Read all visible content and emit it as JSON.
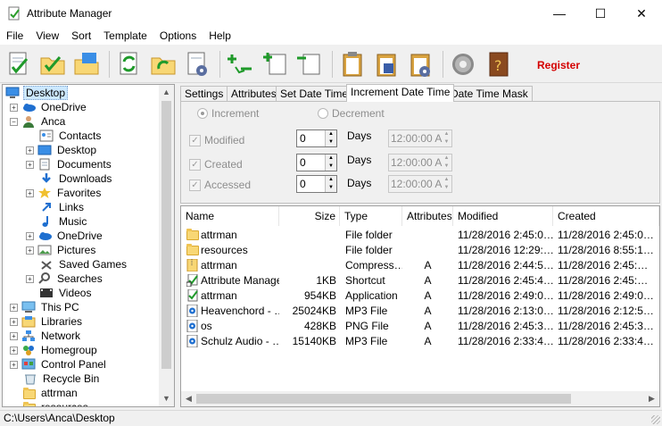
{
  "window": {
    "title": "Attribute Manager",
    "minimize": "—",
    "maximize": "☐",
    "close": "✕"
  },
  "menu": [
    "File",
    "View",
    "Sort",
    "Template",
    "Options",
    "Help"
  ],
  "toolbar": {
    "register_label": "Register"
  },
  "tree": {
    "items": [
      {
        "label": "Desktop",
        "icon": "desktop-icon",
        "expander": ""
      },
      {
        "label": "OneDrive",
        "icon": "cloud-icon",
        "expander": "+"
      },
      {
        "label": "Anca",
        "icon": "user-icon",
        "expander": "−"
      },
      {
        "label": "Contacts",
        "icon": "contacts-icon",
        "expander": ""
      },
      {
        "label": "Desktop",
        "icon": "desktop-icon",
        "expander": "+"
      },
      {
        "label": "Documents",
        "icon": "documents-icon",
        "expander": "+"
      },
      {
        "label": "Downloads",
        "icon": "download-icon",
        "expander": ""
      },
      {
        "label": "Favorites",
        "icon": "star-icon",
        "expander": "+"
      },
      {
        "label": "Links",
        "icon": "links-icon",
        "expander": ""
      },
      {
        "label": "Music",
        "icon": "music-icon",
        "expander": ""
      },
      {
        "label": "OneDrive",
        "icon": "cloud-icon",
        "expander": "+"
      },
      {
        "label": "Pictures",
        "icon": "pictures-icon",
        "expander": "+"
      },
      {
        "label": "Saved Games",
        "icon": "games-icon",
        "expander": ""
      },
      {
        "label": "Searches",
        "icon": "search-icon",
        "expander": "+"
      },
      {
        "label": "Videos",
        "icon": "video-icon",
        "expander": ""
      },
      {
        "label": "This PC",
        "icon": "computer-icon",
        "expander": "+"
      },
      {
        "label": "Libraries",
        "icon": "library-icon",
        "expander": "+"
      },
      {
        "label": "Network",
        "icon": "network-icon",
        "expander": "+"
      },
      {
        "label": "Homegroup",
        "icon": "homegroup-icon",
        "expander": "+"
      },
      {
        "label": "Control Panel",
        "icon": "control-panel-icon",
        "expander": "+"
      },
      {
        "label": "Recycle Bin",
        "icon": "recycle-bin-icon",
        "expander": ""
      },
      {
        "label": "attrman",
        "icon": "folder-icon",
        "expander": ""
      },
      {
        "label": "resources",
        "icon": "folder-icon",
        "expander": ""
      }
    ]
  },
  "tabs": [
    "Settings",
    "Attributes",
    "Set Date Time",
    "Increment Date Time",
    "Date Time Mask"
  ],
  "increment": {
    "increment_label": "Increment",
    "decrement_label": "Decrement",
    "rows": [
      {
        "label": "Modified",
        "value": "0",
        "days_label": "Days",
        "time": "12:00:00 A"
      },
      {
        "label": "Created",
        "value": "0",
        "days_label": "Days",
        "time": "12:00:00 A"
      },
      {
        "label": "Accessed",
        "value": "0",
        "days_label": "Days",
        "time": "12:00:00 A"
      }
    ]
  },
  "files": {
    "columns": [
      "Name",
      "Size",
      "Type",
      "Attributes",
      "Modified",
      "Created"
    ],
    "rows": [
      {
        "name": "attrman",
        "size": "",
        "type": "File folder",
        "attr": "",
        "modified": "11/28/2016 2:45:0…",
        "created": "11/28/2016 2:45:0…",
        "icon": "folder-icon"
      },
      {
        "name": "resources",
        "size": "",
        "type": "File folder",
        "attr": "",
        "modified": "11/28/2016 12:29:…",
        "created": "11/28/2016 8:55:1…",
        "icon": "folder-icon"
      },
      {
        "name": "attrman",
        "size": "",
        "type": "Compress…",
        "attr": "A",
        "modified": "11/28/2016 2:44:5…",
        "created": "11/28/2016 2:45:…",
        "icon": "zip-icon"
      },
      {
        "name": "Attribute Manager",
        "size": "1KB",
        "type": "Shortcut",
        "attr": "A",
        "modified": "11/28/2016 2:45:4…",
        "created": "11/28/2016 2:45:…",
        "icon": "shortcut-icon"
      },
      {
        "name": "attrman",
        "size": "954KB",
        "type": "Application",
        "attr": "A",
        "modified": "11/28/2016 2:49:0…",
        "created": "11/28/2016 2:49:0…",
        "icon": "app-icon"
      },
      {
        "name": "Heavenchord - …",
        "size": "25024KB",
        "type": "MP3 File",
        "attr": "A",
        "modified": "11/28/2016 2:13:0…",
        "created": "11/28/2016 2:12:5…",
        "icon": "mp3-icon"
      },
      {
        "name": "os",
        "size": "428KB",
        "type": "PNG File",
        "attr": "A",
        "modified": "11/28/2016 2:45:3…",
        "created": "11/28/2016 2:45:3…",
        "icon": "png-icon"
      },
      {
        "name": "Schulz Audio - …",
        "size": "15140KB",
        "type": "MP3 File",
        "attr": "A",
        "modified": "11/28/2016 2:33:4…",
        "created": "11/28/2016 2:33:4…",
        "icon": "mp3-icon"
      }
    ]
  },
  "status": {
    "path": "C:\\Users\\Anca\\Desktop"
  },
  "colors": {
    "register": "#d40000",
    "selection": "#cce8ff",
    "folder": "#f8d775",
    "accent": "#3a8ee6"
  }
}
